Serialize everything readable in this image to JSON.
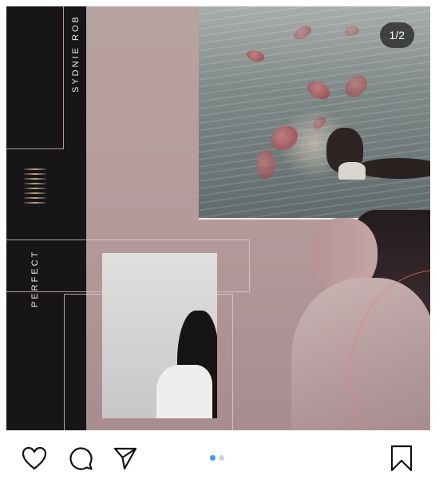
{
  "post": {
    "counter": "1/2",
    "vertical_texts": {
      "name": "SYDNIE ROB",
      "word": "PERFECT"
    },
    "carousel": {
      "count": 2,
      "active_index": 0,
      "active_color": "#3897f0",
      "inactive_color": "#d3d3d3"
    },
    "actions": {
      "like": "heart-icon",
      "comment": "comment-icon",
      "share": "send-icon",
      "save": "bookmark-icon"
    }
  }
}
